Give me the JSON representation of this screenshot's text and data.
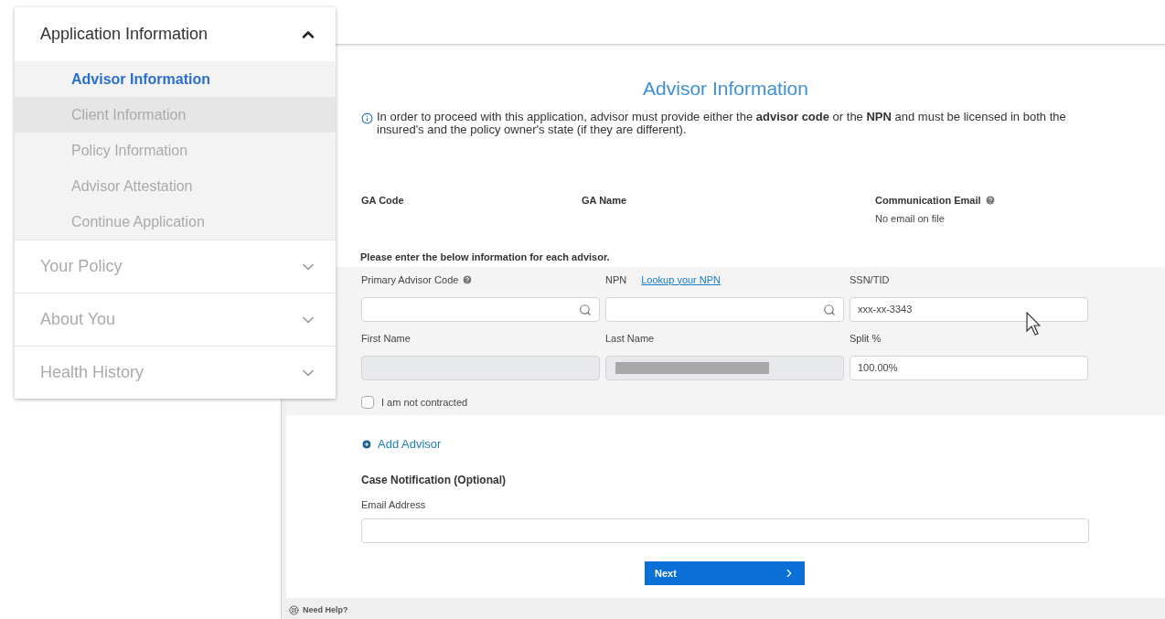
{
  "sidebar": {
    "sections": [
      {
        "label": "Application Information",
        "expanded": true,
        "children": [
          {
            "label": "Advisor Information",
            "selected": true,
            "highlighted": false
          },
          {
            "label": "Client Information",
            "selected": false,
            "highlighted": true
          },
          {
            "label": "Policy Information",
            "selected": false,
            "highlighted": false
          },
          {
            "label": "Advisor Attestation",
            "selected": false,
            "highlighted": false
          },
          {
            "label": "Continue Application",
            "selected": false,
            "highlighted": false
          }
        ]
      },
      {
        "label": "Your Policy",
        "expanded": false
      },
      {
        "label": "About You",
        "expanded": false
      },
      {
        "label": "Health History",
        "expanded": false
      }
    ]
  },
  "form": {
    "title": "Advisor Information",
    "notice": "In order to proceed with this application, advisor must provide either the **advisor code** or the **NPN** and must be licensed in both the insured's and the policy owner's state (if they are different).",
    "ga_fields": [
      {
        "label": "GA Code"
      },
      {
        "label": "GA Name"
      },
      {
        "label": "Communication Email",
        "help": true,
        "value": "No email on file"
      }
    ],
    "advisor_prompt": "Please enter the below information for each advisor.",
    "advisor_fields": [
      {
        "label": "Primary Advisor Code",
        "help": true,
        "search": true,
        "disabled": false
      },
      {
        "label": "NPN",
        "link": "Lookup your NPN",
        "search": true,
        "disabled": false
      },
      {
        "label": "SSN/TID",
        "value": "xxx-xx-3343",
        "search": false,
        "disabled": false
      },
      {
        "label": "First Name",
        "search": false,
        "disabled": true
      },
      {
        "label": "Last Name",
        "search": false,
        "disabled": true,
        "redacted": true
      },
      {
        "label": "Split %",
        "value": "100.00%",
        "search": false,
        "disabled": false
      }
    ],
    "not_contracted": {
      "label": "I am not contracted",
      "checked": false
    },
    "add_advisor": "Add Advisor",
    "case_notification": {
      "heading": "Case Notification (Optional)",
      "label": "Email Address"
    },
    "next_button": "Next"
  },
  "footer": {
    "help": "Need Help?"
  }
}
